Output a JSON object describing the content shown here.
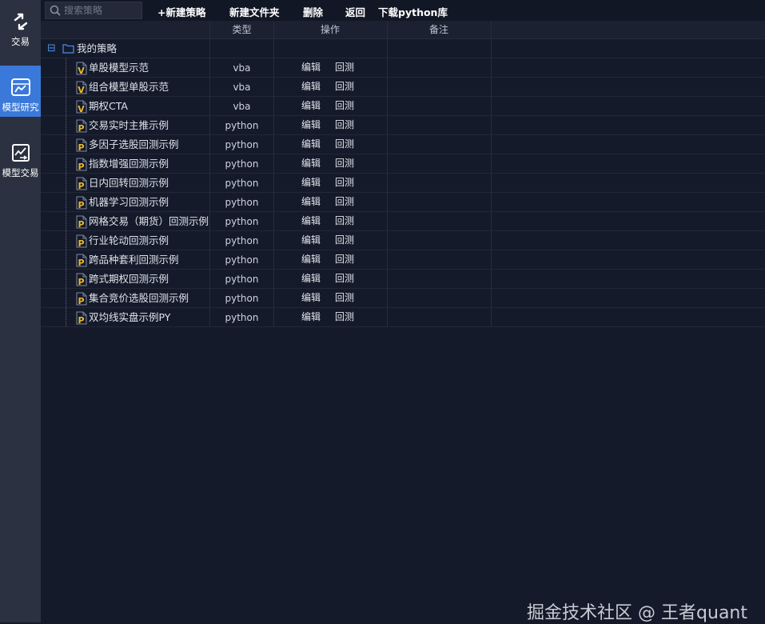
{
  "sidebar": {
    "items": [
      {
        "label": "交易",
        "icon": "swap-arrows-icon",
        "active": false
      },
      {
        "label": "模型研究",
        "icon": "model-research-icon",
        "active": true
      },
      {
        "label": "模型交易",
        "icon": "model-trading-icon",
        "active": false
      }
    ],
    "accent": "#3a79d9"
  },
  "toolbar": {
    "search_placeholder": "搜索策略",
    "new_strategy": "+新建策略",
    "new_folder": "新建文件夹",
    "delete": "删除",
    "back": "返回",
    "download": "下载python库"
  },
  "table": {
    "columns": [
      "类型",
      "操作",
      "备注"
    ],
    "folder": {
      "label": "我的策略",
      "expand_glyph": "⊟"
    },
    "rows": [
      {
        "name": "单股模型示范",
        "type": "vba",
        "icon": "V",
        "edit": "编辑",
        "backtest": "回测"
      },
      {
        "name": "组合模型单股示范",
        "type": "vba",
        "icon": "V",
        "edit": "编辑",
        "backtest": "回测"
      },
      {
        "name": "期权CTA",
        "type": "vba",
        "icon": "V",
        "edit": "编辑",
        "backtest": "回测"
      },
      {
        "name": "交易实时主推示例",
        "type": "python",
        "icon": "P",
        "edit": "编辑",
        "backtest": "回测"
      },
      {
        "name": "多因子选股回测示例",
        "type": "python",
        "icon": "P",
        "edit": "编辑",
        "backtest": "回测"
      },
      {
        "name": "指数增强回测示例",
        "type": "python",
        "icon": "P",
        "edit": "编辑",
        "backtest": "回测"
      },
      {
        "name": "日内回转回测示例",
        "type": "python",
        "icon": "P",
        "edit": "编辑",
        "backtest": "回测"
      },
      {
        "name": "机器学习回测示例",
        "type": "python",
        "icon": "P",
        "edit": "编辑",
        "backtest": "回测"
      },
      {
        "name": "网格交易（期货）回测示例",
        "type": "python",
        "icon": "P",
        "edit": "编辑",
        "backtest": "回测"
      },
      {
        "name": "行业轮动回测示例",
        "type": "python",
        "icon": "P",
        "edit": "编辑",
        "backtest": "回测"
      },
      {
        "name": "跨品种套利回测示例",
        "type": "python",
        "icon": "P",
        "edit": "编辑",
        "backtest": "回测"
      },
      {
        "name": "跨式期权回测示例",
        "type": "python",
        "icon": "P",
        "edit": "编辑",
        "backtest": "回测"
      },
      {
        "name": "集合竞价选股回测示例",
        "type": "python",
        "icon": "P",
        "edit": "编辑",
        "backtest": "回测"
      },
      {
        "name": "双均线实盘示例PY",
        "type": "python",
        "icon": "P",
        "edit": "编辑",
        "backtest": "回测"
      }
    ]
  },
  "watermark": "掘金技术社区 @ 王者quant",
  "colors": {
    "background": "#141a2a",
    "sidebar": "#2b3140",
    "file_icon_letter": "#e8b92a",
    "folder": "#4c8fe8"
  }
}
